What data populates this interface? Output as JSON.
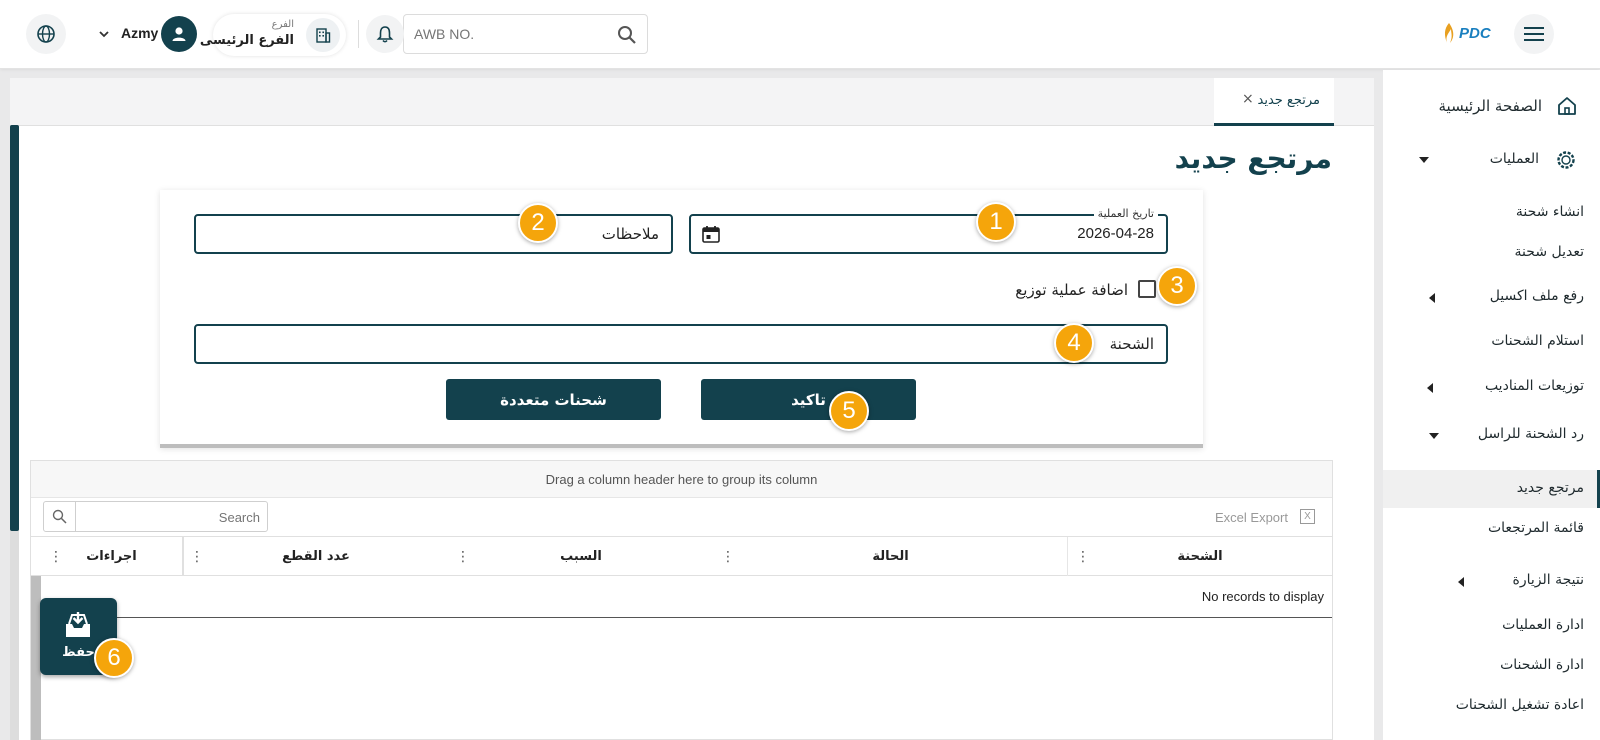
{
  "header": {
    "brand": "PDC",
    "search_placeholder": "AWB NO.",
    "branch_label": "الفرع",
    "branch_value": "الفرع الرئيسى",
    "user_name": "Azmy"
  },
  "sidebar": {
    "home": "الصفحة الرئيسية",
    "operations": "العمليات",
    "items": [
      "انشاء شحنة",
      "تعديل شحنة",
      "رفع ملف اكسيل",
      "استلام الشحنات",
      "توزيعات المناديب",
      "رد الشحنة للراسل",
      "مرتجع جديد",
      "قائمة المرتجعات",
      "نتيجة الزيارة",
      "ادارة العمليات",
      "ادارة الشحنات",
      "اعادة تشغيل الشحنات"
    ]
  },
  "tab": {
    "label": "مرتجع جديد",
    "close": "×"
  },
  "page": {
    "title": "مرتجع جديد"
  },
  "form": {
    "date_label": "تاريخ العملية",
    "date_value": "2026-04-28",
    "notes_placeholder": "ملاحظات",
    "add_distribution_label": "اضافة عملية توزيع",
    "shipment_placeholder": "الشحنة",
    "confirm_button": "تاكيد",
    "multi_button": "شحنات متعددة"
  },
  "grid": {
    "group_hint": "Drag a column header here to group its column",
    "excel_export": "Excel Export",
    "search_placeholder": "Search",
    "columns": [
      "الشحنة",
      "الحالة",
      "السبب",
      "عدد القطع",
      "اجراءات"
    ],
    "empty_text": "No records to display"
  },
  "save_button": "حفظ",
  "badges": [
    "1",
    "2",
    "3",
    "4",
    "5",
    "6"
  ],
  "colors": {
    "primary": "#13414d",
    "accent": "#f5a50b"
  }
}
